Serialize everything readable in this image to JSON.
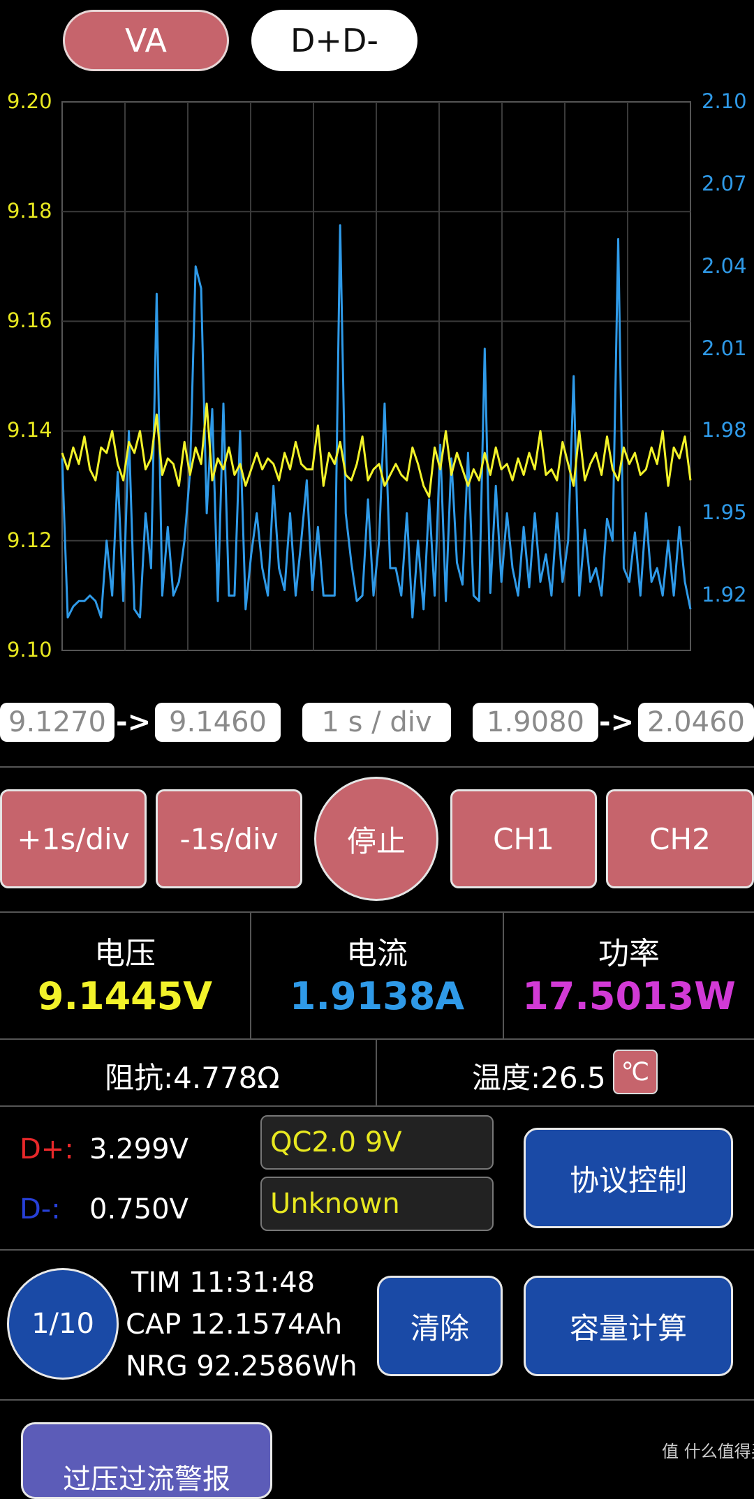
{
  "tabs": {
    "va": "VA",
    "dd": "D+D-"
  },
  "chart_data": {
    "type": "line",
    "left_axis": {
      "ticks": [
        "9.20",
        "9.18",
        "9.16",
        "9.14",
        "9.12",
        "9.10"
      ],
      "range": [
        9.1,
        9.2
      ],
      "color": "#e8e820"
    },
    "right_axis": {
      "ticks": [
        "2.10",
        "2.07",
        "2.04",
        "2.01",
        "1.98",
        "1.95",
        "1.92"
      ],
      "range": [
        1.9,
        2.1
      ],
      "color": "#2f9ae8"
    },
    "grid": true,
    "series": [
      {
        "axis": "left",
        "color": "#f2f22a",
        "values": [
          9.136,
          9.133,
          9.137,
          9.134,
          9.139,
          9.133,
          9.131,
          9.137,
          9.136,
          9.14,
          9.134,
          9.131,
          9.138,
          9.136,
          9.14,
          9.133,
          9.135,
          9.143,
          9.132,
          9.135,
          9.134,
          9.13,
          9.138,
          9.132,
          9.137,
          9.134,
          9.145,
          9.131,
          9.135,
          9.133,
          9.137,
          9.132,
          9.134,
          9.13,
          9.133,
          9.136,
          9.133,
          9.135,
          9.134,
          9.131,
          9.136,
          9.133,
          9.138,
          9.134,
          9.133,
          9.133,
          9.141,
          9.13,
          9.136,
          9.134,
          9.138,
          9.132,
          9.131,
          9.134,
          9.139,
          9.131,
          9.133,
          9.134,
          9.13,
          9.132,
          9.134,
          9.132,
          9.131,
          9.137,
          9.134,
          9.13,
          9.128,
          9.137,
          9.133,
          9.14,
          9.132,
          9.136,
          9.133,
          9.13,
          9.133,
          9.131,
          9.136,
          9.132,
          9.137,
          9.133,
          9.134,
          9.131,
          9.135,
          9.132,
          9.136,
          9.133,
          9.14,
          9.132,
          9.133,
          9.131,
          9.138,
          9.134,
          9.13,
          9.14,
          9.131,
          9.134,
          9.136,
          9.132,
          9.139,
          9.133,
          9.131,
          9.137,
          9.134,
          9.136,
          9.132,
          9.133,
          9.137,
          9.134,
          9.14,
          9.13,
          9.137,
          9.135,
          9.139,
          9.131
        ]
      },
      {
        "axis": "right",
        "color": "#2f9ae8",
        "values": [
          1.97,
          1.912,
          1.916,
          1.918,
          1.918,
          1.92,
          1.918,
          1.912,
          1.94,
          1.92,
          1.965,
          1.918,
          1.98,
          1.915,
          1.912,
          1.95,
          1.93,
          2.03,
          1.92,
          1.945,
          1.92,
          1.925,
          1.94,
          1.965,
          2.04,
          2.032,
          1.95,
          1.988,
          1.918,
          1.99,
          1.92,
          1.92,
          1.98,
          1.915,
          1.935,
          1.95,
          1.93,
          1.92,
          1.96,
          1.93,
          1.922,
          1.95,
          1.92,
          1.94,
          1.962,
          1.922,
          1.945,
          1.92,
          1.92,
          1.92,
          2.055,
          1.95,
          1.932,
          1.918,
          1.92,
          1.955,
          1.92,
          1.94,
          1.99,
          1.93,
          1.93,
          1.92,
          1.95,
          1.912,
          1.94,
          1.915,
          1.955,
          1.92,
          1.975,
          1.918,
          1.97,
          1.932,
          1.924,
          1.972,
          1.92,
          1.918,
          2.01,
          1.921,
          1.96,
          1.925,
          1.95,
          1.93,
          1.92,
          1.945,
          1.923,
          1.95,
          1.925,
          1.935,
          1.92,
          1.95,
          1.925,
          1.94,
          2.0,
          1.92,
          1.944,
          1.925,
          1.93,
          1.92,
          1.948,
          1.94,
          2.05,
          1.93,
          1.925,
          1.943,
          1.92,
          1.95,
          1.925,
          1.93,
          1.92,
          1.94,
          1.92,
          1.945,
          1.925,
          1.915
        ]
      }
    ]
  },
  "ranges": {
    "left_min": "9.1270",
    "left_max": "9.1460",
    "timebase": "1 s / div",
    "right_min": "1.9080",
    "right_max": "2.0460",
    "arrow": "->"
  },
  "controls": {
    "plus": "+1s/div",
    "minus": "-1s/div",
    "stop": "停止",
    "ch1": "CH1",
    "ch2": "CH2"
  },
  "meters": {
    "voltage_label": "电压",
    "voltage_value": "9.1445V",
    "voltage_color": "#f2f22a",
    "current_label": "电流",
    "current_value": "1.9138A",
    "current_color": "#2f9ae8",
    "power_label": "功率",
    "power_value": "17.5013W",
    "power_color": "#d23ad6"
  },
  "impedance": "阻抗:4.778Ω",
  "temperature": "温度:26.5",
  "temp_unit": "℃",
  "dplus": {
    "label": "D+:",
    "value": "3.299V",
    "color": "#e8282a"
  },
  "dminus": {
    "label": "D-:",
    "value": "0.750V",
    "color": "#2740d8"
  },
  "protocol": {
    "primary": "QC2.0 9V",
    "secondary": "Unknown",
    "button": "协议控制"
  },
  "record": {
    "page": "1/10",
    "tim": "TIM 11:31:48",
    "cap": "CAP 12.1574Ah",
    "nrg": "NRG 92.2586Wh",
    "clear": "清除",
    "calc": "容量计算"
  },
  "bottom_button": "过压过流警报",
  "watermark": "值 什么值得买"
}
